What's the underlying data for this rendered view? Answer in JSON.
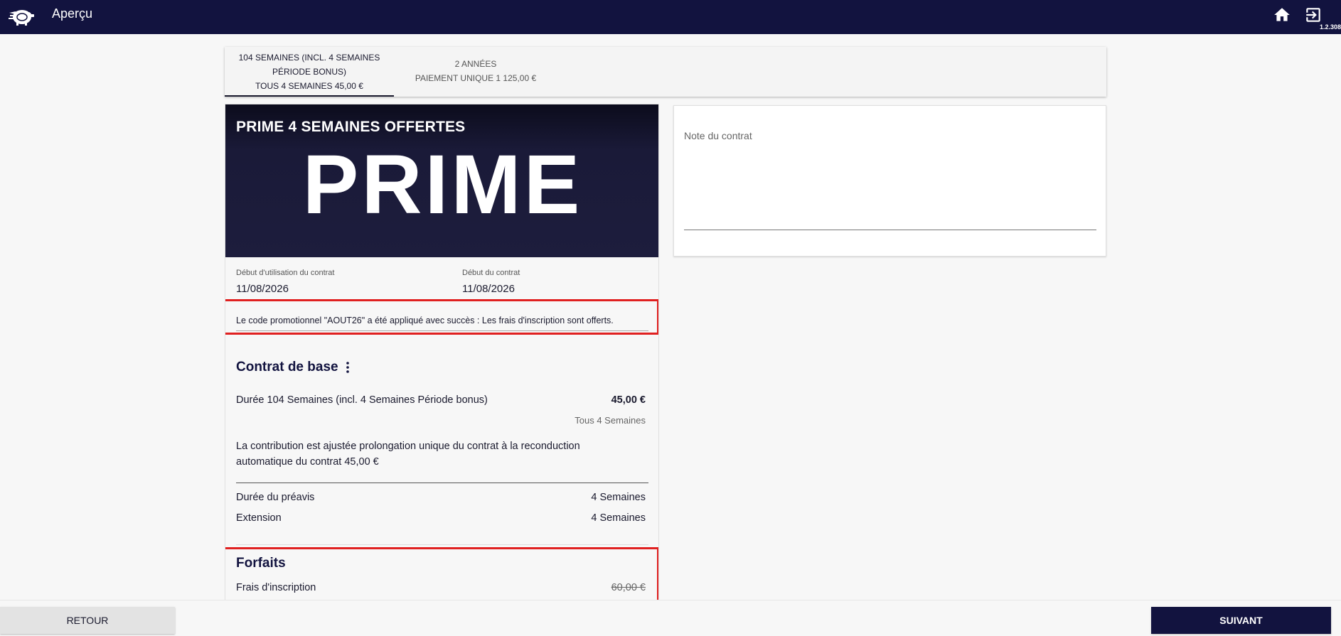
{
  "header": {
    "title": "Aperçu",
    "version": "1.2.308",
    "icons": {
      "logo": "piggy-bank-logo",
      "home": "home-icon",
      "logout": "logout-icon"
    }
  },
  "tabs": [
    {
      "lines": [
        "104 SEMAINES (INCL. 4 SEMAINES",
        "PÉRIODE BONUS)",
        "TOUS 4 SEMAINES 45,00 €"
      ],
      "active": true
    },
    {
      "lines": [
        "2 ANNÉES",
        "PAIEMENT UNIQUE 1 125,00 €"
      ],
      "active": false
    }
  ],
  "offer": {
    "title": "PRIME 4 SEMAINES OFFERTES",
    "logo_text": "PRIME",
    "usage_start_label": "Début d'utilisation du contrat",
    "usage_start_value": "11/08/2026",
    "contract_start_label": "Début du contrat",
    "contract_start_value": "11/08/2026",
    "promo_message": "Le code promotionnel \"AOUT26\" a été appliqué avec succès : Les frais d'inscription sont offerts."
  },
  "base_contract": {
    "title": "Contrat de base",
    "duration_label": "Durée 104 Semaines (incl. 4 Semaines Période bonus)",
    "duration_price": "45,00 €",
    "duration_frequency": "Tous 4 Semaines",
    "contribution_line1": "La contribution est ajustée prolongation unique du contrat à la reconduction",
    "contribution_line2": "automatique du contrat 45,00 €",
    "notice_label": "Durée du préavis",
    "notice_value": "4 Semaines",
    "extension_label": "Extension",
    "extension_value": "4 Semaines"
  },
  "packages": {
    "title": "Forfaits",
    "fee_label": "Frais d'inscription",
    "fee_value": "60,00 €"
  },
  "note": {
    "label": "Note du contrat"
  },
  "footer": {
    "back_label": "RETOUR",
    "next_label": "SUIVANT"
  },
  "colors": {
    "primary": "#12133f",
    "highlight": "#e02020"
  }
}
